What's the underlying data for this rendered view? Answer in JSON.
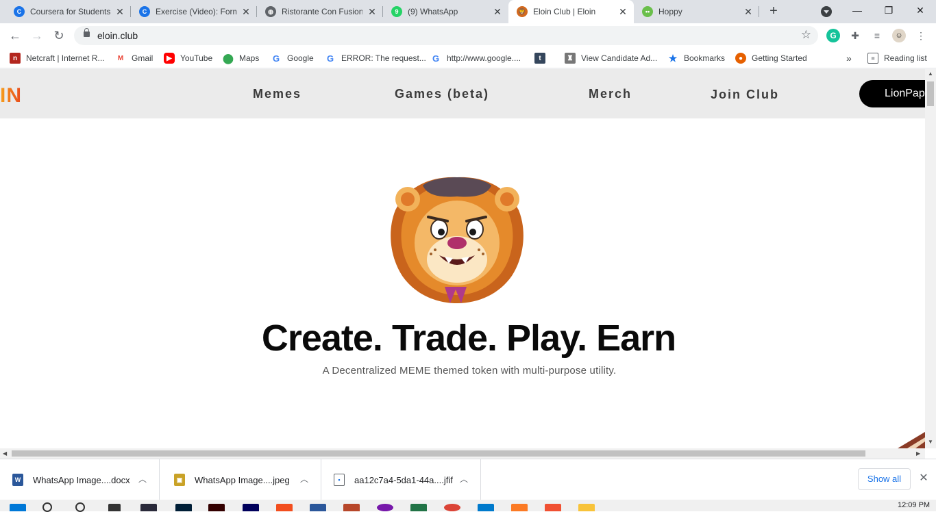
{
  "tabs": [
    {
      "title": "Coursera for Students",
      "favicon": "coursera-icon",
      "color": "#1a73e8",
      "active": false
    },
    {
      "title": "Exercise (Video): Form",
      "favicon": "coursera-icon",
      "color": "#1a73e8",
      "active": false
    },
    {
      "title": "Ristorante Con Fusion",
      "favicon": "globe-icon",
      "color": "#5f6368",
      "active": false
    },
    {
      "title": "(9) WhatsApp",
      "favicon": "whatsapp-icon",
      "color": "#25d366",
      "badge": "9",
      "active": false
    },
    {
      "title": "Eloin Club | Eloin",
      "favicon": "lion-icon",
      "color": "#d2691e",
      "active": true
    },
    {
      "title": "Hoppy",
      "favicon": "frog-icon",
      "color": "#6abf4b",
      "active": false
    }
  ],
  "toolbar": {
    "url": "eloin.club"
  },
  "bookmarks": [
    {
      "label": "Netcraft | Internet R...",
      "icon": "netcraft-icon",
      "color": "#b3261e"
    },
    {
      "label": "Gmail",
      "icon": "gmail-icon",
      "color": "#ea4335"
    },
    {
      "label": "YouTube",
      "icon": "youtube-icon",
      "color": "#ff0000"
    },
    {
      "label": "Maps",
      "icon": "maps-pin-icon",
      "color": "#34a853"
    },
    {
      "label": "Google",
      "icon": "google-icon",
      "color": "#4285f4"
    },
    {
      "label": "ERROR: The request...",
      "icon": "google-icon",
      "color": "#4285f4"
    },
    {
      "label": "http://www.google....",
      "icon": "google-icon",
      "color": "#4285f4"
    },
    {
      "label": "",
      "icon": "tumblr-icon",
      "color": "#35465c"
    },
    {
      "label": "View Candidate Ad...",
      "icon": "emblem-icon",
      "color": "#777777"
    },
    {
      "label": "Bookmarks",
      "icon": "star-icon",
      "color": "#1a73e8"
    },
    {
      "label": "Getting Started",
      "icon": "firefox-icon",
      "color": "#e66000"
    }
  ],
  "bookmarks_more": "»",
  "reading_list": "Reading list",
  "site": {
    "logo_fragment": "IN",
    "nav": [
      "Memes",
      "Games (beta)",
      "Merch",
      "Join Club"
    ],
    "cta": "LionPap",
    "hero_title": "Create. Trade. Play. Earn",
    "hero_subtitle": "A Decentralized MEME themed token with multi-purpose utility."
  },
  "downloads": [
    {
      "name": "WhatsApp Image....docx",
      "icon": "word-file-icon",
      "color": "#2b579a"
    },
    {
      "name": "WhatsApp Image....jpeg",
      "icon": "image-file-icon",
      "color": "#c9a227"
    },
    {
      "name": "aa12c7a4-5da1-44a....jfif",
      "icon": "generic-file-icon",
      "color": "#5f6368"
    }
  ],
  "show_all": "Show all",
  "taskbar": {
    "clock": "12:09 PM",
    "apps": [
      {
        "icon": "photoshop-icon",
        "color": "#001e36"
      },
      {
        "icon": "illustrator-icon",
        "color": "#330000"
      },
      {
        "icon": "premiere-icon",
        "color": "#00005b"
      },
      {
        "icon": "figma-icon",
        "color": "#f24e1e"
      },
      {
        "icon": "word-icon",
        "color": "#2b579a"
      },
      {
        "icon": "powerpoint-icon",
        "color": "#b7472a"
      },
      {
        "icon": "onenote-icon",
        "color": "#7719aa"
      },
      {
        "icon": "excel-icon",
        "color": "#217346"
      },
      {
        "icon": "chrome-icon",
        "color": "#db4437"
      },
      {
        "icon": "vscode-icon",
        "color": "#007acc"
      },
      {
        "icon": "xampp-icon",
        "color": "#fb7a24"
      },
      {
        "icon": "git-icon",
        "color": "#f05032"
      },
      {
        "icon": "folder-icon",
        "color": "#f8c33a"
      }
    ]
  }
}
